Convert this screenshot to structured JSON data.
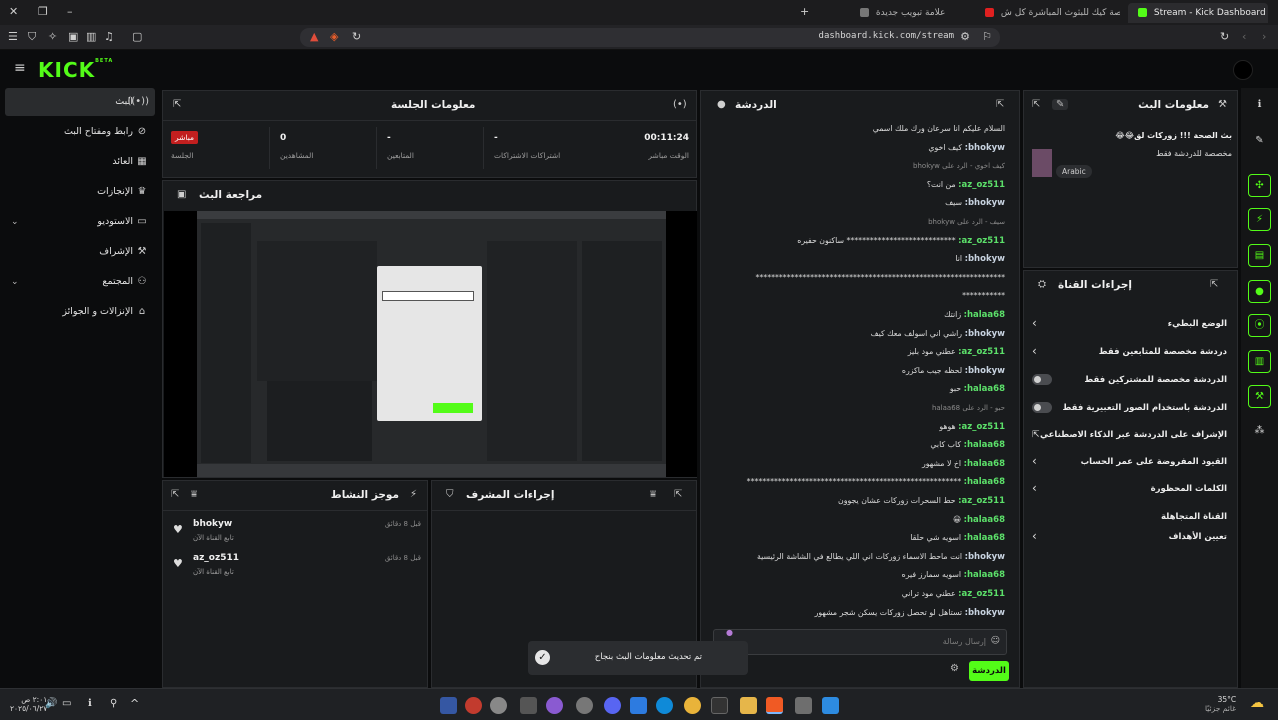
{
  "browser": {
    "tabs": [
      {
        "label": "Stream - Kick Dashboard",
        "active": true
      },
      {
        "label": "شرح منصة كيك للبثوث المباشرة كل ش...",
        "active": false
      },
      {
        "label": "علامة تبويب جديدة",
        "active": false
      }
    ],
    "new_tab": "+",
    "url": "dashboard.kick.com/stream"
  },
  "brand": {
    "logo": "KICK",
    "beta": "BETA",
    "accent": "#53fc18"
  },
  "nav": {
    "items": [
      {
        "label": "البث",
        "icon": "broadcast-icon",
        "glyph": "((•))",
        "active": true
      },
      {
        "label": "رابط ومفتاح البث",
        "icon": "link-icon",
        "glyph": "⊘"
      },
      {
        "label": "العائد",
        "icon": "revenue-icon",
        "glyph": "▦"
      },
      {
        "label": "الإنجازات",
        "icon": "trophy-icon",
        "glyph": "♛"
      },
      {
        "label": "الاستوديو",
        "icon": "studio-icon",
        "glyph": "▭",
        "chevron": "⌄"
      },
      {
        "label": "الإشراف",
        "icon": "wrench-icon",
        "glyph": "⚒"
      },
      {
        "label": "المجتمع",
        "icon": "community-icon",
        "glyph": "⚇",
        "chevron": "⌄"
      },
      {
        "label": "الإنزالات و الجوائز",
        "icon": "gift-icon",
        "glyph": "⌂"
      }
    ]
  },
  "session": {
    "title": "معلومات الجلسة",
    "stats": [
      {
        "value": "00:11:24",
        "label": "الوقت مباشر"
      },
      {
        "value": "-",
        "label": "اشتراكات الاشتراكات"
      },
      {
        "value": "-",
        "label": "المتابعين"
      },
      {
        "value": "0",
        "label": "المشاهدين"
      },
      {
        "value": "مباشر",
        "label": "الجلسة"
      }
    ]
  },
  "preview": {
    "title": "مراجعة البث"
  },
  "activity": {
    "title": "موجز النشاط",
    "rows": [
      {
        "name": "bhokyw",
        "sub": "تابع القناة الآن",
        "time": "قبل 8 دقائق"
      },
      {
        "name": "az_oz511",
        "sub": "تابع القناة الآن",
        "time": "قبل 8 دقائق"
      }
    ]
  },
  "mod_actions": {
    "title": "إجراءات المشرف"
  },
  "chat": {
    "title": "الدردشة",
    "messages": [
      {
        "user": "",
        "text": "السلام عليكم انا سرعان ورك ملك اسمي"
      },
      {
        "user": "bhokyw:",
        "text": "كيف اخوي"
      },
      {
        "user": "",
        "reply": "كيف اخوي - الرد على bhokyw",
        "text": ""
      },
      {
        "user": "az_oz511:",
        "text": "من انت؟"
      },
      {
        "user": "bhokyw:",
        "text": "سيف"
      },
      {
        "user": "",
        "reply": "سيف - الرد على bhokyw",
        "text": ""
      },
      {
        "user": "az_oz511:",
        "text": "**************************** ساكنون حفيره"
      },
      {
        "user": "bhokyw:",
        "text": "انا"
      },
      {
        "user": "",
        "text": "****************************************************************"
      },
      {
        "user": "",
        "text": "***********"
      },
      {
        "user": "halaa68:",
        "text": "زانتك"
      },
      {
        "user": "bhokyw:",
        "text": "راشي اني اسولف معك كيف"
      },
      {
        "user": "az_oz511:",
        "text": "عطني مود بليز"
      },
      {
        "user": "bhokyw:",
        "text": "لحظه جيب ماكزره"
      },
      {
        "user": "halaa68:",
        "text": "حبو"
      },
      {
        "user": "",
        "reply": "حبو - الرد على halaa68",
        "text": ""
      },
      {
        "user": "az_oz511:",
        "text": "هوهو"
      },
      {
        "user": "halaa68:",
        "text": "كاب كابي"
      },
      {
        "user": "halaa68:",
        "text": "اخ لا مشهور"
      },
      {
        "user": "halaa68:",
        "text": "*******************************************************"
      },
      {
        "user": "az_oz511:",
        "text": "حط السحرات زوركات عشان يجوون"
      },
      {
        "user": "halaa68:",
        "text": "😀"
      },
      {
        "user": "halaa68:",
        "text": "اسويه شي حلقا"
      },
      {
        "user": "bhokyw:",
        "text": "انت ماحط الاسماء زوركات اني اللي يطالع في الشاشة الرئيسية"
      },
      {
        "user": "halaa68:",
        "text": "اسويه سمارز فيره"
      },
      {
        "user": "az_oz511:",
        "text": "عطني مود تراني"
      },
      {
        "user": "bhokyw:",
        "text": "تستاهل لو تحصل زوركات يسكن شجر مشهور"
      }
    ],
    "input_placeholder": "إرسال رسالة",
    "send_label": "الدردشة"
  },
  "stream_info": {
    "title": "معلومات البث",
    "stream_title": "بث الصحة !!! زوركات لق😂😂",
    "category_line": "مخصصة للدردشة فقط",
    "language": "Arabic"
  },
  "channel_actions": {
    "title": "إجراءات القناة",
    "rows": [
      {
        "label": "الوضع البطيء",
        "control": "chevron"
      },
      {
        "label": "دردشة مخصصة للمتابعين فقط",
        "control": "chevron"
      },
      {
        "label": "الدردشة مخصصة للمشتركين فقط",
        "control": "toggle"
      },
      {
        "label": "الدردشة باستخدام الصور التعبيرية فقط",
        "control": "toggle"
      },
      {
        "label": "الإشراف على الدردشة عبر الذكاء الاصطناعي",
        "control": "external"
      },
      {
        "label": "القيود المفروضة على عمر الحساب",
        "control": "chevron"
      },
      {
        "label": "الكلمات المحظورة",
        "control": "chevron"
      },
      {
        "label": "القناة المتجاهلة",
        "control": "none"
      },
      {
        "label": "تعيين الأهداف",
        "control": "chevron"
      }
    ]
  },
  "toast": {
    "text": "تم تحديث معلومات البث بنجاح"
  },
  "taskbar": {
    "weather": "35°C",
    "weather_sub": "غائم جزئيًا",
    "time": "٢:٠١ ص",
    "date": "٢٠٢٥/٠٦/٢٧"
  }
}
